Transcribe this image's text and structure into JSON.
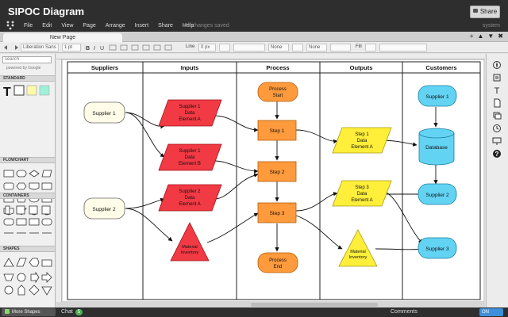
{
  "app": {
    "title": "SIPOC Diagram",
    "share_label": "Share",
    "menu": [
      "File",
      "Edit",
      "View",
      "Page",
      "Arrange",
      "Insert",
      "Share",
      "Help"
    ],
    "save_status": "All changes saved",
    "user": "system"
  },
  "tabs": {
    "items": [
      "New Page"
    ],
    "add": "+",
    "actions": [
      "▲",
      "▼",
      "✖"
    ]
  },
  "toolbar": {
    "font": "Liberation Sans",
    "font_size": "1 pt",
    "line_label": "Line",
    "line_width": "0 px",
    "none1": "None",
    "none2": "None",
    "fill_label": "Fill"
  },
  "left_panel": {
    "search_placeholder": "search",
    "powered_by": "powered by Google",
    "sections": [
      "STANDARD",
      "FLOWCHART",
      "CONTAINERS",
      "SHAPES"
    ]
  },
  "diagram": {
    "headers": [
      "Suppliers",
      "Inputs",
      "Process",
      "Outputs",
      "Customers"
    ],
    "suppliers": [
      "Supplier 1",
      "Supplier 2"
    ],
    "inputs": [
      [
        "Supplier 1",
        "Data",
        "Element A"
      ],
      [
        "Supplier 1",
        "Data",
        "Element B"
      ],
      [
        "Supplier 2",
        "Data",
        "Element A"
      ],
      [
        "Material",
        "Inventory"
      ]
    ],
    "process": {
      "start": [
        "Process",
        "Start"
      ],
      "steps": [
        "Step 1",
        "Step 2",
        "Step 3"
      ],
      "end": [
        "Process",
        "End"
      ]
    },
    "outputs": [
      [
        "Step 1",
        "Data",
        "Element A"
      ],
      [
        "Step 3",
        "Data",
        "Element A"
      ],
      [
        "Material",
        "Inventory"
      ]
    ],
    "customers": [
      "Supplier 1",
      "Database",
      "Supplier 2",
      "Supplier 3"
    ],
    "colors": {
      "supplier_fill": "#fffde7",
      "input_fill": "#f23a44",
      "process_fill": "#ff9a3d",
      "output_fill": "#ffef3a",
      "customer_fill": "#63d3f4"
    }
  },
  "status": {
    "more_shapes": "More Shapes",
    "chat_label": "Chat",
    "chat_count": "5",
    "comments_label": "Comments",
    "toggle": "ON"
  },
  "icons": [
    "logo-icon",
    "lock-icon",
    "compass-icon",
    "format-icon",
    "text-icon",
    "page-icon",
    "layers-icon",
    "history-icon",
    "present-icon",
    "help-icon"
  ]
}
